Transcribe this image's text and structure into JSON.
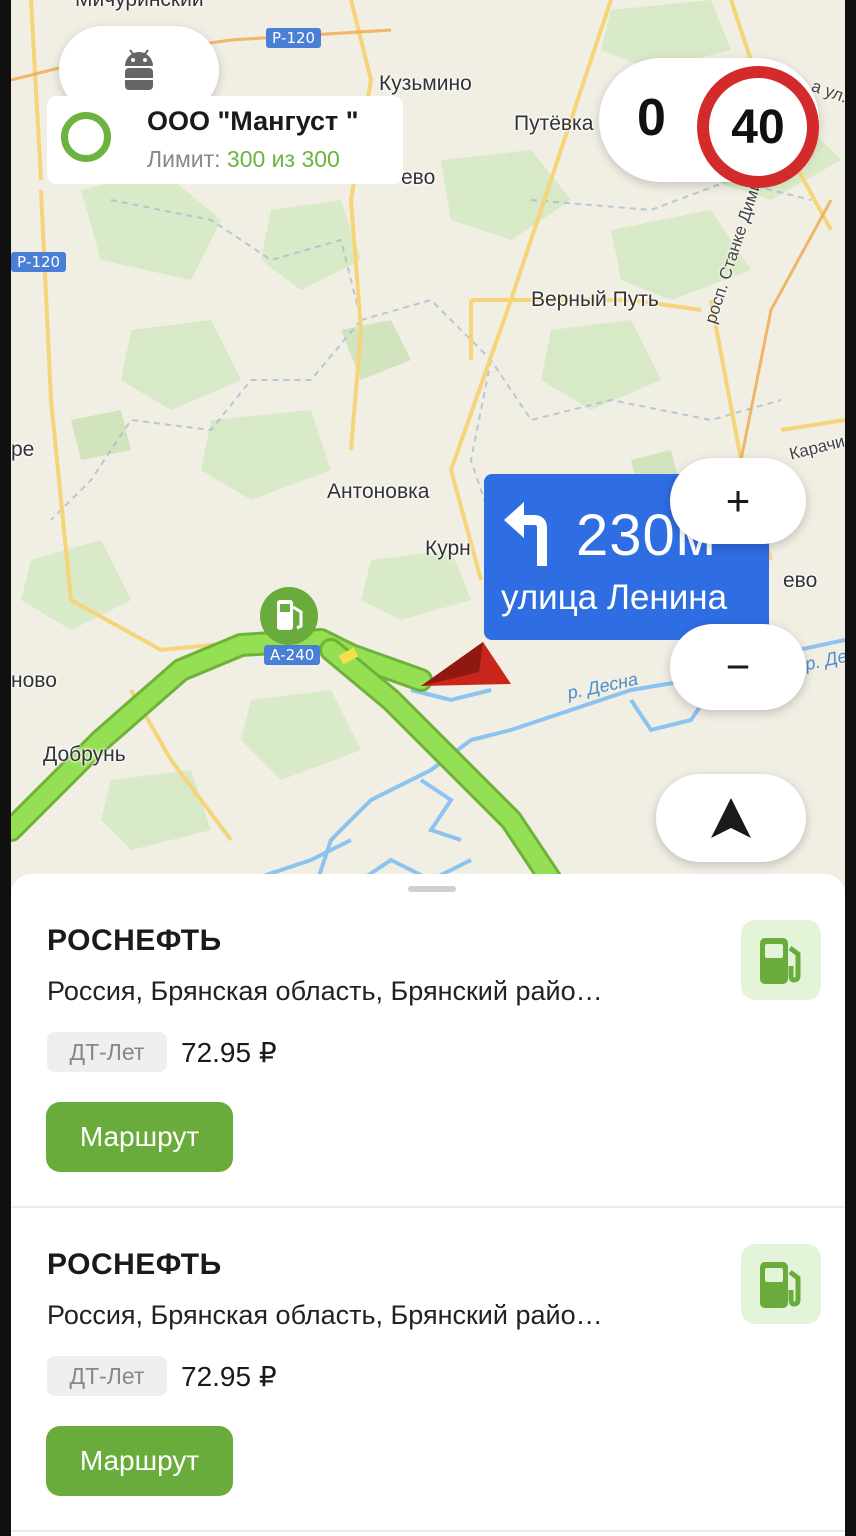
{
  "map": {
    "places": [
      "Мичуринский",
      "Кузьмино",
      "Путёвка",
      "ево",
      "Верный Путь",
      "Антоновка",
      "Курн",
      "ево",
      "ново",
      "Добрунь",
      "ре"
    ],
    "roads": [
      "Р-120",
      "Р-120",
      "А-240"
    ],
    "river": "р. Десна",
    "streets": [
      "росп. Станке Димитрова",
      "Карачи",
      "р. Де",
      "а ул."
    ]
  },
  "org": {
    "name": "ООО \"Мангуст \"",
    "limit_label": "Лимит:",
    "limit_value": "300 из 300"
  },
  "speed": {
    "current": "0",
    "limit": "40"
  },
  "maneuver": {
    "distance": "230м",
    "street": "улица Ленина"
  },
  "controls": {
    "zoom_in": "+",
    "zoom_out": "−"
  },
  "stations": [
    {
      "name": "РОСНЕФТЬ",
      "address": "Россия, Брянская область, Брянский райо…",
      "fuel": "ДТ-Лет",
      "price": "72.95 ₽",
      "route_label": "Маршрут"
    },
    {
      "name": "РОСНЕФТЬ",
      "address": "Россия, Брянская область, Брянский райо…",
      "fuel": "ДТ-Лет",
      "price": "72.95 ₽",
      "route_label": "Маршрут"
    }
  ],
  "colors": {
    "route": "#8fdc4a",
    "accent_green": "#6aac3c",
    "maneuver_blue": "#2f6de3",
    "speed_ring": "#d32b2b"
  },
  "icons": [
    "android-icon",
    "fuel-pump-icon",
    "turn-left-icon",
    "navigation-arrow-icon",
    "location-arrow-icon"
  ]
}
